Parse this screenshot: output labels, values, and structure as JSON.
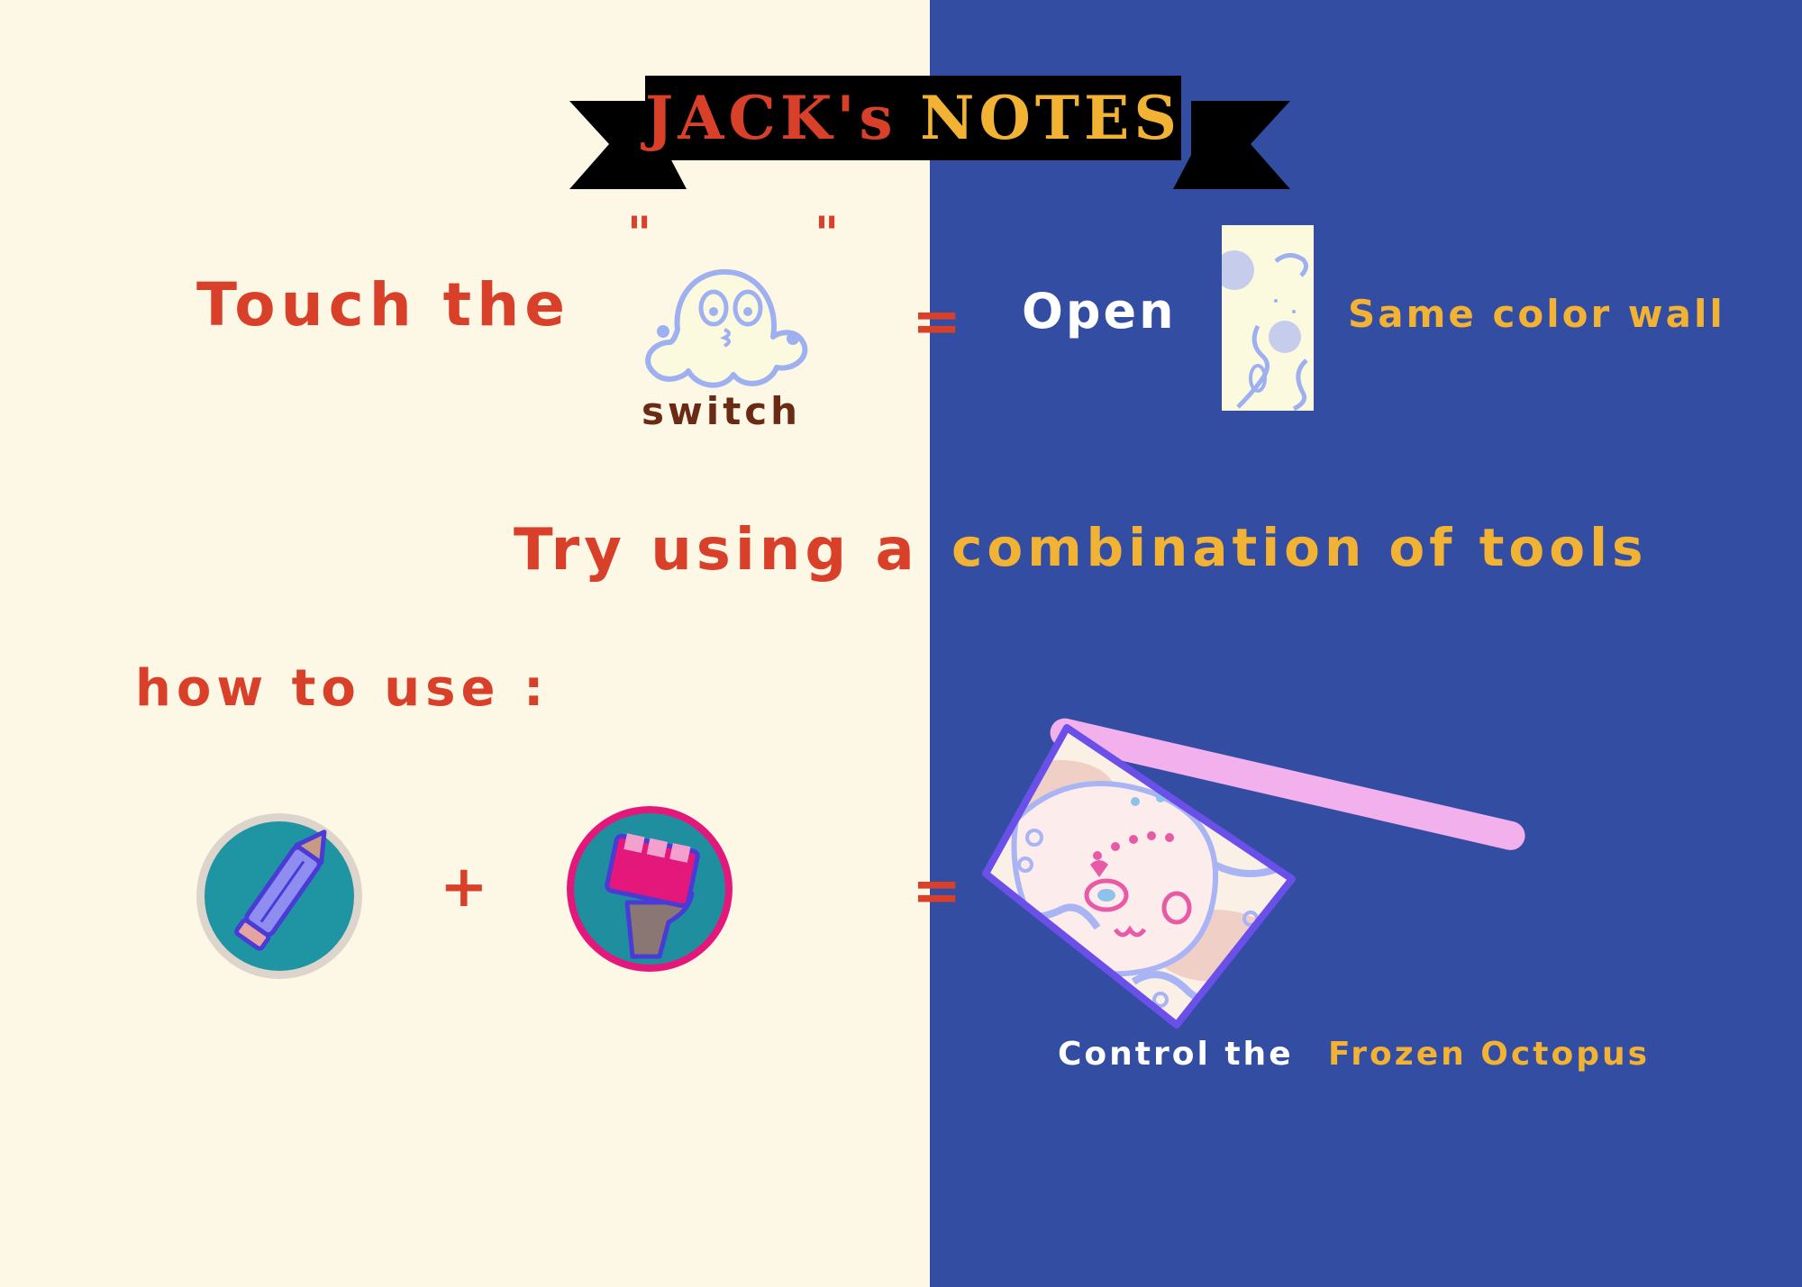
{
  "colors": {
    "left_bg": "#fdf8e6",
    "right_bg": "#334da3",
    "orange": "#d9402a",
    "yellow": "#f2b233",
    "brown": "#6b2a14",
    "white": "#ffffff",
    "pink_bar": "#f2b0ec"
  },
  "title": {
    "part1": "JACK's",
    "part2": "NOTES"
  },
  "rule1": {
    "touch": "Touch the",
    "open_quote": "\"",
    "close_quote": "\"",
    "switch_icon": "ghost-switch-icon",
    "switch_label": "switch",
    "equals": "=",
    "open": "Open",
    "wall_icon": "wall-panel-icon",
    "wall_label": "Same color wall"
  },
  "hint": {
    "part_orange": "Try using a",
    "part_yellow": "combination of tools"
  },
  "howto": {
    "label": "how to use :",
    "tool1_icon": "pencil-tool-icon",
    "plus": "+",
    "tool2_icon": "grab-hand-tool-icon",
    "equals": "=",
    "result_icon": "frozen-octopus-icon",
    "caption_white": "Control the",
    "caption_yellow": "Frozen Octopus"
  }
}
